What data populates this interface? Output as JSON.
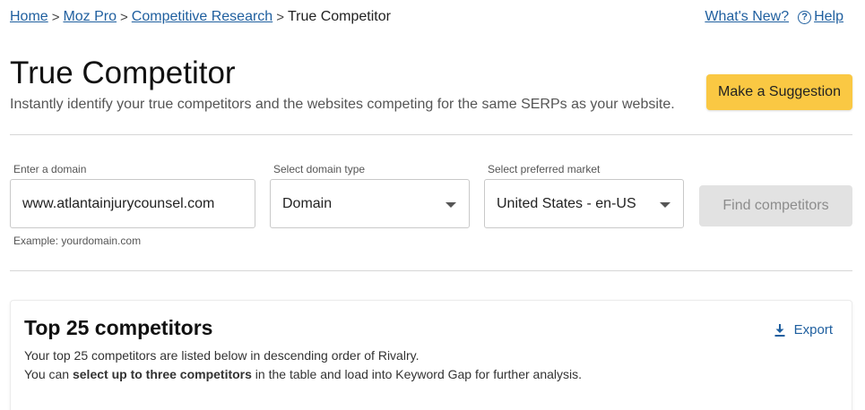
{
  "breadcrumb": {
    "items": [
      "Home",
      "Moz Pro",
      "Competitive Research"
    ],
    "separator": ">",
    "current": "True Competitor"
  },
  "toplinks": {
    "whats_new": "What's New?",
    "help_glyph": "?",
    "help": "Help"
  },
  "header": {
    "title": "True Competitor",
    "subtitle": "Instantly identify your true competitors and the websites competing for the same SERPs as your website.",
    "suggestion_button": "Make a Suggestion"
  },
  "form": {
    "domain_label": "Enter a domain",
    "domain_value": "www.atlantainjurycounsel.com",
    "domain_hint": "Example: yourdomain.com",
    "type_label": "Select domain type",
    "type_value": "Domain",
    "market_label": "Select preferred market",
    "market_value": "United States - en-US",
    "find_button": "Find competitors"
  },
  "results": {
    "title": "Top 25 competitors",
    "export": "Export",
    "line1": "Your top 25 competitors are listed below in descending order of Rivalry.",
    "line2_prefix": "You can ",
    "line2_bold": "select up to three competitors",
    "line2_suffix": " in the table and load into Keyword Gap for further analysis."
  },
  "colors": {
    "link": "#1f5f9f",
    "accent_button": "#fac843",
    "disabled_button": "#e2e2e2"
  },
  "icons": {
    "help": "help-circle-icon",
    "export": "download-icon",
    "dropdown": "caret-down-icon"
  }
}
